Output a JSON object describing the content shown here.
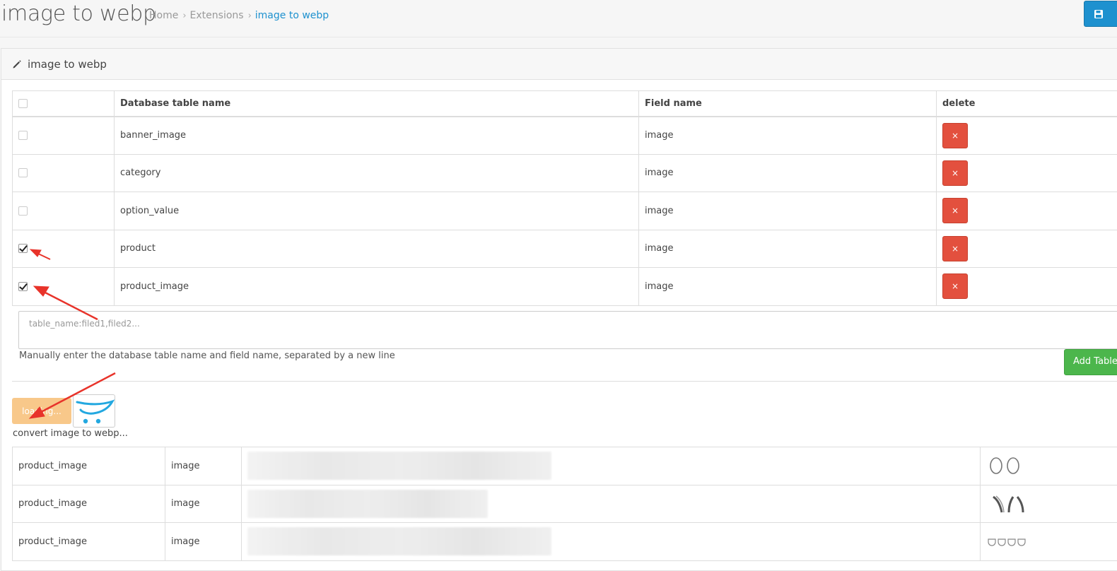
{
  "header": {
    "title": "image to webp",
    "breadcrumb": [
      "Home",
      "Extensions",
      "image to webp"
    ]
  },
  "panel": {
    "title": "image to webp"
  },
  "db_table": {
    "columns": [
      "Database table name",
      "Field name",
      "delete"
    ],
    "rows": [
      {
        "table": "banner_image",
        "field": "image",
        "checked": false,
        "delete_label": "×"
      },
      {
        "table": "category",
        "field": "image",
        "checked": false,
        "delete_label": "×"
      },
      {
        "table": "option_value",
        "field": "image",
        "checked": false,
        "delete_label": "×"
      },
      {
        "table": "product",
        "field": "image",
        "checked": true,
        "delete_label": "×"
      },
      {
        "table": "product_image",
        "field": "image",
        "checked": true,
        "delete_label": "×"
      }
    ]
  },
  "manual_input": {
    "placeholder": "table_name:filed1,filed2...",
    "help": "Manually enter the database table name and field name, separated by a new line",
    "add_button": "Add Table"
  },
  "convert": {
    "button_label": "loading...",
    "status": "convert image to webp..."
  },
  "log_table": {
    "rows": [
      {
        "table": "product_image",
        "field": "image",
        "thumb": "rings-icon"
      },
      {
        "table": "product_image",
        "field": "image",
        "thumb": "brushes-icon"
      },
      {
        "table": "product_image",
        "field": "image",
        "thumb": "bowls-icon"
      }
    ]
  },
  "colors": {
    "primary": "#1e91cf",
    "danger": "#e3503e",
    "success": "#4cb64c",
    "warning": "#f8c88a",
    "annotation": "#e8332a"
  }
}
